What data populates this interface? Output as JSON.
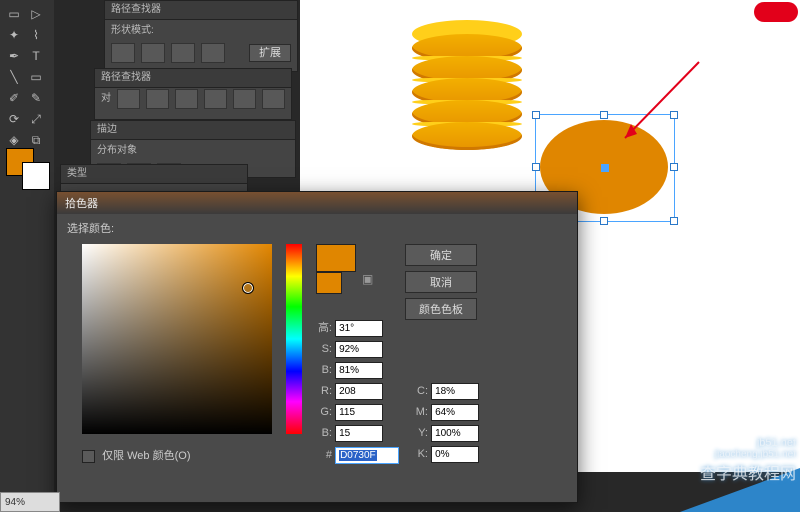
{
  "panels": {
    "pathfinder": {
      "tab": "路径查找器",
      "label": "形状模式:",
      "expand": "扩展"
    },
    "pathfinder2": {
      "tab": "路径查找器",
      "label": "对"
    },
    "align": {
      "label": "分布对象",
      "align_tab": "描边"
    },
    "typepanel": {
      "tab": "类型"
    }
  },
  "color_picker": {
    "title": "拾色器",
    "select_label": "选择颜色:",
    "buttons": {
      "ok": "确定",
      "cancel": "取消",
      "swatches": "颜色色板"
    },
    "hsb": {
      "h_label": "高:",
      "s_label": "S:",
      "b_label": "B:",
      "h": "31°",
      "s": "92%",
      "b": "81%"
    },
    "rgb": {
      "r_label": "R:",
      "g_label": "G:",
      "b_label": "B:",
      "r": "208",
      "g": "115",
      "b": "15"
    },
    "cmyk": {
      "c_label": "C:",
      "m_label": "M:",
      "y_label": "Y:",
      "k_label": "K:",
      "c": "18%",
      "m": "64%",
      "y": "100%",
      "k": "0%"
    },
    "hex_label": "#",
    "hex": "D0730F",
    "web_only": "仅限 Web 颜色(O)"
  },
  "status": {
    "zoom": "94%"
  },
  "watermark": {
    "host": "jb51.net",
    "sub": "jiaocheng.jb51.net",
    "cn": "查字典教程网"
  },
  "colors": {
    "fill": "#e08600"
  }
}
